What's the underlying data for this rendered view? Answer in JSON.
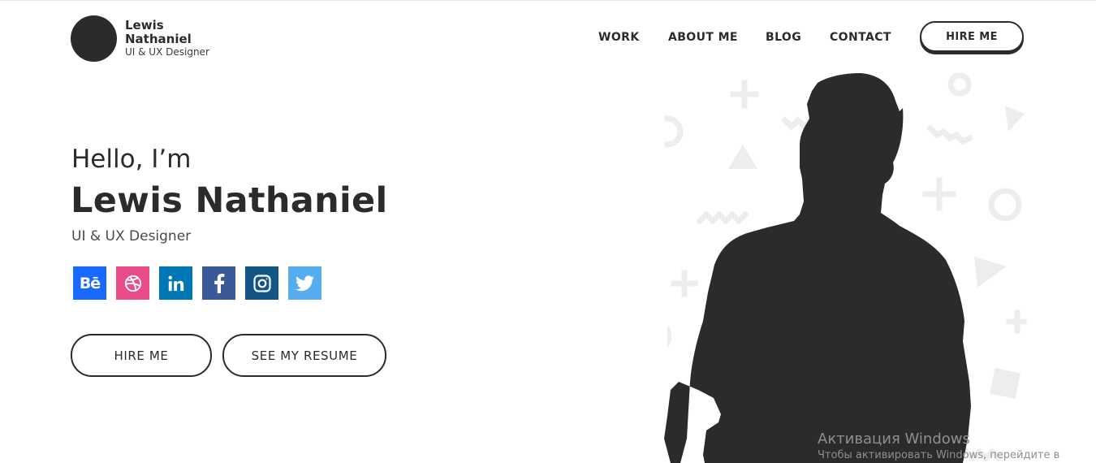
{
  "brand": {
    "name": "Lewis Nathaniel",
    "role": "UI & UX Designer"
  },
  "nav": {
    "items": [
      {
        "label": "WORK"
      },
      {
        "label": "ABOUT ME"
      },
      {
        "label": "BLOG"
      },
      {
        "label": "CONTACT"
      }
    ],
    "cta_label": "HIRE ME"
  },
  "hero": {
    "greeting": "Hello, I’m",
    "name": "Lewis Nathaniel",
    "role": "UI & UX Designer",
    "hire_label": "HIRE ME",
    "resume_label": "SEE MY RESUME"
  },
  "social": [
    {
      "name": "behance-icon",
      "glyph": "Bē",
      "color": "#1769ff"
    },
    {
      "name": "dribbble-icon",
      "color": "#ea4c89"
    },
    {
      "name": "linkedin-icon",
      "color": "#0077b5"
    },
    {
      "name": "facebook-icon",
      "color": "#3b5998"
    },
    {
      "name": "instagram-icon",
      "color": "#125688"
    },
    {
      "name": "twitter-icon",
      "color": "#55acee"
    }
  ],
  "watermark": {
    "line1": "Активация Windows",
    "line2": "Чтобы активировать Windows, перейдите в"
  },
  "colors": {
    "text": "#2b2b2d",
    "background": "#ffffff",
    "decor": "#eeeeee"
  }
}
